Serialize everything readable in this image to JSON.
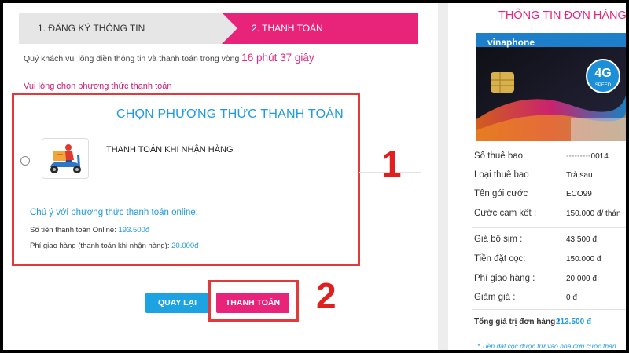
{
  "steps": {
    "step1": "1. ĐĂNG KÝ THÔNG TIN",
    "step2": "2. THANH TOÁN"
  },
  "notice": {
    "text": "Quý khách vui lòng điền thông tin và thanh toán trong vòng",
    "timer": "16 phút 37 giây"
  },
  "choose_hint": "Vui lòng chọn phương thức thanh toán",
  "payment": {
    "title": "CHỌN PHƯƠNG THỨC THANH TOÁN",
    "cod_label": "THANH TOÁN KHI NHẬN HÀNG",
    "icon": "delivery-scooter-icon",
    "online_note": "Chú ý với phương thức thanh toán online:",
    "online_amount_label": "Số tiền thanh toán Online:",
    "online_amount_value": "193.500đ",
    "ship_fee_label": "Phí giao hàng (thanh toán khi nhận hàng):",
    "ship_fee_value": "20.000đ"
  },
  "buttons": {
    "back": "QUAY LẠI",
    "pay": "THANH TOÁN"
  },
  "annotations": {
    "one": "1",
    "two": "2"
  },
  "order": {
    "title": "THÔNG TIN ĐƠN HÀNG",
    "sim_brand": "vinaphone",
    "badge_big": "4G",
    "badge_small": "SPEED",
    "rows": [
      {
        "label": "Số thuê bao",
        "value": "0014",
        "obscured_prefix": "•••••••••"
      },
      {
        "label": "Loại thuê bao",
        "value": "Trả sau"
      },
      {
        "label": "Tên gói cước",
        "value": "ECO99"
      },
      {
        "label": "Cước cam kết :",
        "value": "150.000 đ/ thán"
      },
      {
        "label": "Giá bộ sim :",
        "value": "43.500 đ"
      },
      {
        "label": "Tiền đặt cọc:",
        "value": "150.000 đ"
      },
      {
        "label": "Phí giao hàng :",
        "value": "20.000 đ"
      },
      {
        "label": "Giảm giá :",
        "value": "0 đ"
      }
    ],
    "total_label": "Tổng giá trị đơn hàng :",
    "total_value": "213.500 đ",
    "footnote": "* Tiền đặt cọc được trừ vào hoá đơn cước thán"
  },
  "colors": {
    "accent_pink": "#e8247a",
    "accent_blue": "#1e9ae0",
    "annotation_red": "#e01f1f"
  }
}
